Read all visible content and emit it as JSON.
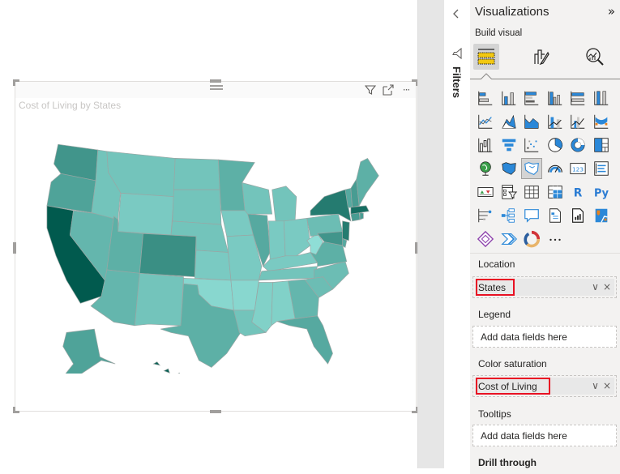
{
  "visual": {
    "title": "Cost of Living by States",
    "actions": {
      "filter_icon": "funnel-icon",
      "focus_icon": "focus-mode-icon",
      "more_icon": "more-options-icon",
      "more_label": "···"
    }
  },
  "filters_pane": {
    "label": "Filters",
    "collapse_icon": "chevron-left-icon",
    "filter_icon": "funnel-icon",
    "collapse_glyph": "<"
  },
  "visualizations_pane": {
    "title": "Visualizations",
    "expand_glyph": "»",
    "build_visual_label": "Build visual",
    "tabs": [
      {
        "name": "build-visual",
        "icon": "fields-icon",
        "active": true
      },
      {
        "name": "format-visual",
        "icon": "format-brush-icon",
        "active": false
      },
      {
        "name": "analytics",
        "icon": "analytics-magnifier-icon",
        "active": false
      }
    ],
    "visual_types": [
      "stacked-bar-chart",
      "stacked-column-chart",
      "clustered-bar-chart",
      "clustered-column-chart",
      "100-stacked-bar-chart",
      "100-stacked-column-chart",
      "line-chart",
      "area-chart",
      "stacked-area-chart",
      "line-and-stacked-column-chart",
      "line-and-clustered-column-chart",
      "ribbon-chart",
      "waterfall-chart",
      "funnel-chart",
      "scatter-chart",
      "pie-chart",
      "donut-chart",
      "treemap",
      "map",
      "filled-map",
      "shape-map",
      "gauge",
      "card",
      "multi-row-card",
      "kpi",
      "slicer",
      "table",
      "matrix",
      "r-script-visual",
      "python-visual",
      "key-influencers",
      "decomposition-tree",
      "qa-visual",
      "smart-narrative",
      "paginated-report",
      "azure-map",
      "power-apps",
      "power-automate",
      "arcgis-map",
      "more-visuals"
    ],
    "selected_visual": "shape-map",
    "r_label": "R",
    "py_label": "Py",
    "card_label": "123",
    "more_label": "···",
    "wells": {
      "location": {
        "label": "Location",
        "value": "States"
      },
      "legend": {
        "label": "Legend",
        "placeholder": "Add data fields here"
      },
      "color_saturation": {
        "label": "Color saturation",
        "value": "Cost of Living"
      },
      "tooltips": {
        "label": "Tooltips",
        "placeholder": "Add data fields here"
      },
      "drill_through": {
        "label": "Drill through"
      }
    },
    "pill_controls": {
      "dropdown": "∨",
      "remove": "×"
    }
  },
  "chart_data": {
    "type": "heatmap",
    "subtype": "filled-map",
    "title": "Cost of Living by States",
    "measure": "Cost of Living",
    "location_field": "States",
    "color_scale": {
      "low": "#8fded6",
      "high": "#015a4e"
    },
    "note": "Relative color saturation levels (0 = lightest, 1 = darkest) estimated from shading",
    "states": [
      {
        "state": "WA",
        "level": 0.55
      },
      {
        "state": "OR",
        "level": 0.45
      },
      {
        "state": "CA",
        "level": 1.0
      },
      {
        "state": "NV",
        "level": 0.3
      },
      {
        "state": "ID",
        "level": 0.2
      },
      {
        "state": "MT",
        "level": 0.2
      },
      {
        "state": "WY",
        "level": 0.15
      },
      {
        "state": "UT",
        "level": 0.35
      },
      {
        "state": "CO",
        "level": 0.6
      },
      {
        "state": "AZ",
        "level": 0.3
      },
      {
        "state": "NM",
        "level": 0.2
      },
      {
        "state": "ND",
        "level": 0.2
      },
      {
        "state": "SD",
        "level": 0.2
      },
      {
        "state": "NE",
        "level": 0.2
      },
      {
        "state": "KS",
        "level": 0.15
      },
      {
        "state": "OK",
        "level": 0.05
      },
      {
        "state": "TX",
        "level": 0.35
      },
      {
        "state": "MN",
        "level": 0.35
      },
      {
        "state": "IA",
        "level": 0.15
      },
      {
        "state": "MO",
        "level": 0.15
      },
      {
        "state": "AR",
        "level": 0.05
      },
      {
        "state": "LA",
        "level": 0.2
      },
      {
        "state": "WI",
        "level": 0.2
      },
      {
        "state": "IL",
        "level": 0.4
      },
      {
        "state": "MI",
        "level": 0.2
      },
      {
        "state": "IN",
        "level": 0.15
      },
      {
        "state": "OH",
        "level": 0.15
      },
      {
        "state": "KY",
        "level": 0.15
      },
      {
        "state": "TN",
        "level": 0.2
      },
      {
        "state": "MS",
        "level": 0.1
      },
      {
        "state": "AL",
        "level": 0.1
      },
      {
        "state": "GA",
        "level": 0.3
      },
      {
        "state": "FL",
        "level": 0.4
      },
      {
        "state": "SC",
        "level": 0.25
      },
      {
        "state": "NC",
        "level": 0.25
      },
      {
        "state": "VA",
        "level": 0.35
      },
      {
        "state": "WV",
        "level": 0.0
      },
      {
        "state": "PA",
        "level": 0.25
      },
      {
        "state": "NY",
        "level": 0.75
      },
      {
        "state": "NJ",
        "level": 0.75
      },
      {
        "state": "DE",
        "level": 0.4
      },
      {
        "state": "MD",
        "level": 0.55
      },
      {
        "state": "CT",
        "level": 0.5
      },
      {
        "state": "RI",
        "level": 0.5
      },
      {
        "state": "MA",
        "level": 0.85
      },
      {
        "state": "VT",
        "level": 0.4
      },
      {
        "state": "NH",
        "level": 0.5
      },
      {
        "state": "ME",
        "level": 0.35
      },
      {
        "state": "AK",
        "level": 0.45
      },
      {
        "state": "HI",
        "level": 0.95
      }
    ]
  }
}
